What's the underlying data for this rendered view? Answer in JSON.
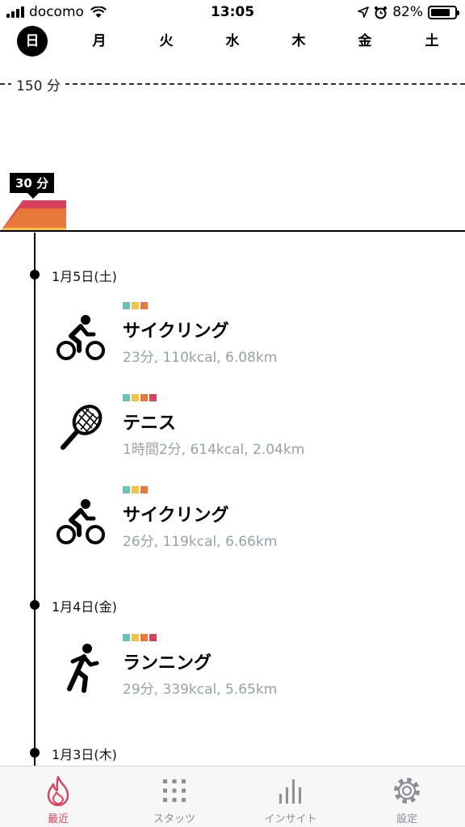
{
  "status_bar": {
    "carrier": "docomo",
    "time": "13:05",
    "battery": "82%",
    "battery_level": 0.82
  },
  "days": [
    {
      "label": "日",
      "active": true
    },
    {
      "label": "月",
      "active": false
    },
    {
      "label": "火",
      "active": false
    },
    {
      "label": "水",
      "active": false
    },
    {
      "label": "木",
      "active": false
    },
    {
      "label": "金",
      "active": false
    },
    {
      "label": "土",
      "active": false
    }
  ],
  "chart": {
    "max_label": "150 分",
    "tooltip": "30 分",
    "colors": [
      "#f5c342",
      "#e9783b",
      "#d9415f"
    ]
  },
  "timeline": [
    {
      "date": "1月5日(土)",
      "activities": [
        {
          "name": "サイクリング",
          "stats": "23分, 110kcal, 6.08km",
          "icon": "cycling-icon",
          "tags": [
            "#6cc3b5",
            "#f5c342",
            "#e9783b"
          ]
        },
        {
          "name": "テニス",
          "stats": "1時間2分, 614kcal, 2.04km",
          "icon": "tennis-icon",
          "tags": [
            "#6cc3b5",
            "#f5c342",
            "#e9783b",
            "#d9415f"
          ]
        },
        {
          "name": "サイクリング",
          "stats": "26分, 119kcal, 6.66km",
          "icon": "cycling-icon",
          "tags": [
            "#6cc3b5",
            "#f5c342",
            "#e9783b"
          ]
        }
      ]
    },
    {
      "date": "1月4日(金)",
      "activities": [
        {
          "name": "ランニング",
          "stats": "29分, 339kcal, 5.65km",
          "icon": "running-icon",
          "tags": [
            "#6cc3b5",
            "#f5c342",
            "#e9783b",
            "#d9415f"
          ]
        }
      ]
    },
    {
      "date": "1月3日(木)",
      "activities": []
    }
  ],
  "tabbar": {
    "tabs": [
      {
        "label": "最近",
        "icon": "flame-icon",
        "active": true
      },
      {
        "label": "スタッツ",
        "icon": "grid-icon",
        "active": false
      },
      {
        "label": "インサイト",
        "icon": "bars-icon",
        "active": false
      },
      {
        "label": "設定",
        "icon": "gear-icon",
        "active": false
      }
    ]
  }
}
